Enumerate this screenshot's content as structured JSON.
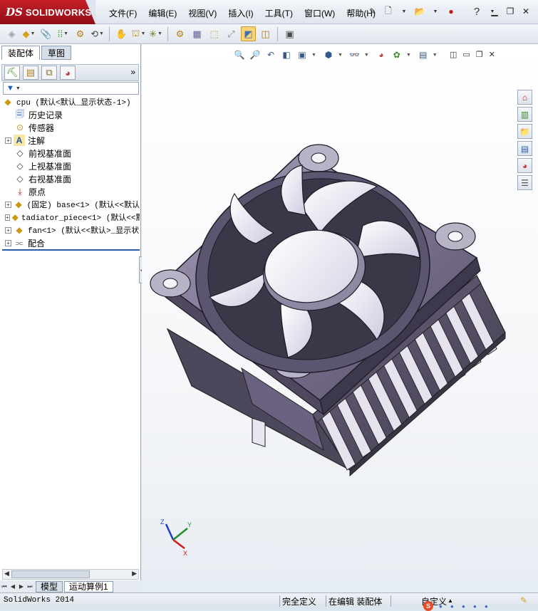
{
  "app": {
    "logo_ds": "DS",
    "logo_name": "SOLIDWORKS",
    "menu": [
      "文件(F)",
      "编辑(E)",
      "视图(V)",
      "插入(I)",
      "工具(T)",
      "窗口(W)",
      "帮助(H)"
    ],
    "help_icon": "?",
    "window_controls": [
      "minimize",
      "restore",
      "close"
    ]
  },
  "toolbar": {
    "icons": [
      "new-part-icon",
      "open-icon",
      "edit-component-icon",
      "mate-icon",
      "linear-pattern-icon",
      "smart-fasteners-icon",
      "move-component-icon",
      "show-hidden-icon",
      "assembly-features-icon",
      "reference-geometry-icon",
      "new-motion-study-icon",
      "bill-of-materials-icon",
      "exploded-view-icon",
      "explode-line-sketch-icon",
      "interference-detection-icon",
      "clearance-verification-icon",
      "hole-alignment-icon",
      "measure-icon"
    ]
  },
  "left_panel": {
    "tabs": [
      "装配体",
      "草图"
    ],
    "selected_tab": 0,
    "manager_tabs": [
      "feature-manager-icon",
      "property-manager-icon",
      "configuration-manager-icon",
      "display-manager-icon"
    ],
    "more_label": "»",
    "filter_icon": "filter-icon",
    "tree": [
      {
        "indent": 0,
        "expander": "",
        "icon": "assembly-icon",
        "label": "cpu  (默认<默认_显示状态-1>)",
        "mono": true
      },
      {
        "indent": 1,
        "expander": "",
        "icon": "history-icon",
        "label": "历史记录"
      },
      {
        "indent": 1,
        "expander": "",
        "icon": "sensor-icon",
        "label": "传感器"
      },
      {
        "indent": 1,
        "expander": "+",
        "icon": "annotation-icon",
        "label": "注解"
      },
      {
        "indent": 1,
        "expander": "",
        "icon": "plane-icon",
        "label": "前视基准面"
      },
      {
        "indent": 1,
        "expander": "",
        "icon": "plane-icon",
        "label": "上视基准面"
      },
      {
        "indent": 1,
        "expander": "",
        "icon": "plane-icon",
        "label": "右视基准面"
      },
      {
        "indent": 1,
        "expander": "",
        "icon": "origin-icon",
        "label": "原点"
      },
      {
        "indent": 1,
        "expander": "+",
        "icon": "part-icon",
        "label": "(固定) base<1> (默认<<默认",
        "mono": true
      },
      {
        "indent": 1,
        "expander": "+",
        "icon": "part-icon",
        "label": "tadiator_piece<1> (默认<<默",
        "mono": true
      },
      {
        "indent": 1,
        "expander": "+",
        "icon": "part-icon",
        "label": "fan<1> (默认<<默认>_显示状",
        "mono": true
      },
      {
        "indent": 1,
        "expander": "+",
        "icon": "mates-icon",
        "label": "配合"
      }
    ],
    "sheet_tabs": [
      "模型",
      "运动算例1"
    ]
  },
  "viewport": {
    "headsup_icons": [
      "zoom-to-fit-icon",
      "zoom-to-area-icon",
      "previous-view-icon",
      "section-view-icon",
      "view-orientation-icon",
      "display-style-icon",
      "hide-show-items-icon",
      "edit-appearance-icon",
      "apply-scene-icon",
      "view-settings-icon"
    ],
    "taskpane_icons": [
      "solidworks-resources-icon",
      "design-library-icon",
      "file-explorer-icon",
      "view-palette-icon",
      "appearances-icon",
      "custom-properties-icon"
    ],
    "triad": {
      "x": "X",
      "y": "Y",
      "z": "Z"
    },
    "model_name": "cpu"
  },
  "status": {
    "app_name": "SolidWorks 2014",
    "definition": "完全定义",
    "editing": "在编辑 装配体",
    "units": "自定义"
  },
  "colors": {
    "accent_red": "#c8202a",
    "model_dark": "#4a4558",
    "model_mid": "#6e6682",
    "blade_light": "#eceaf6"
  }
}
